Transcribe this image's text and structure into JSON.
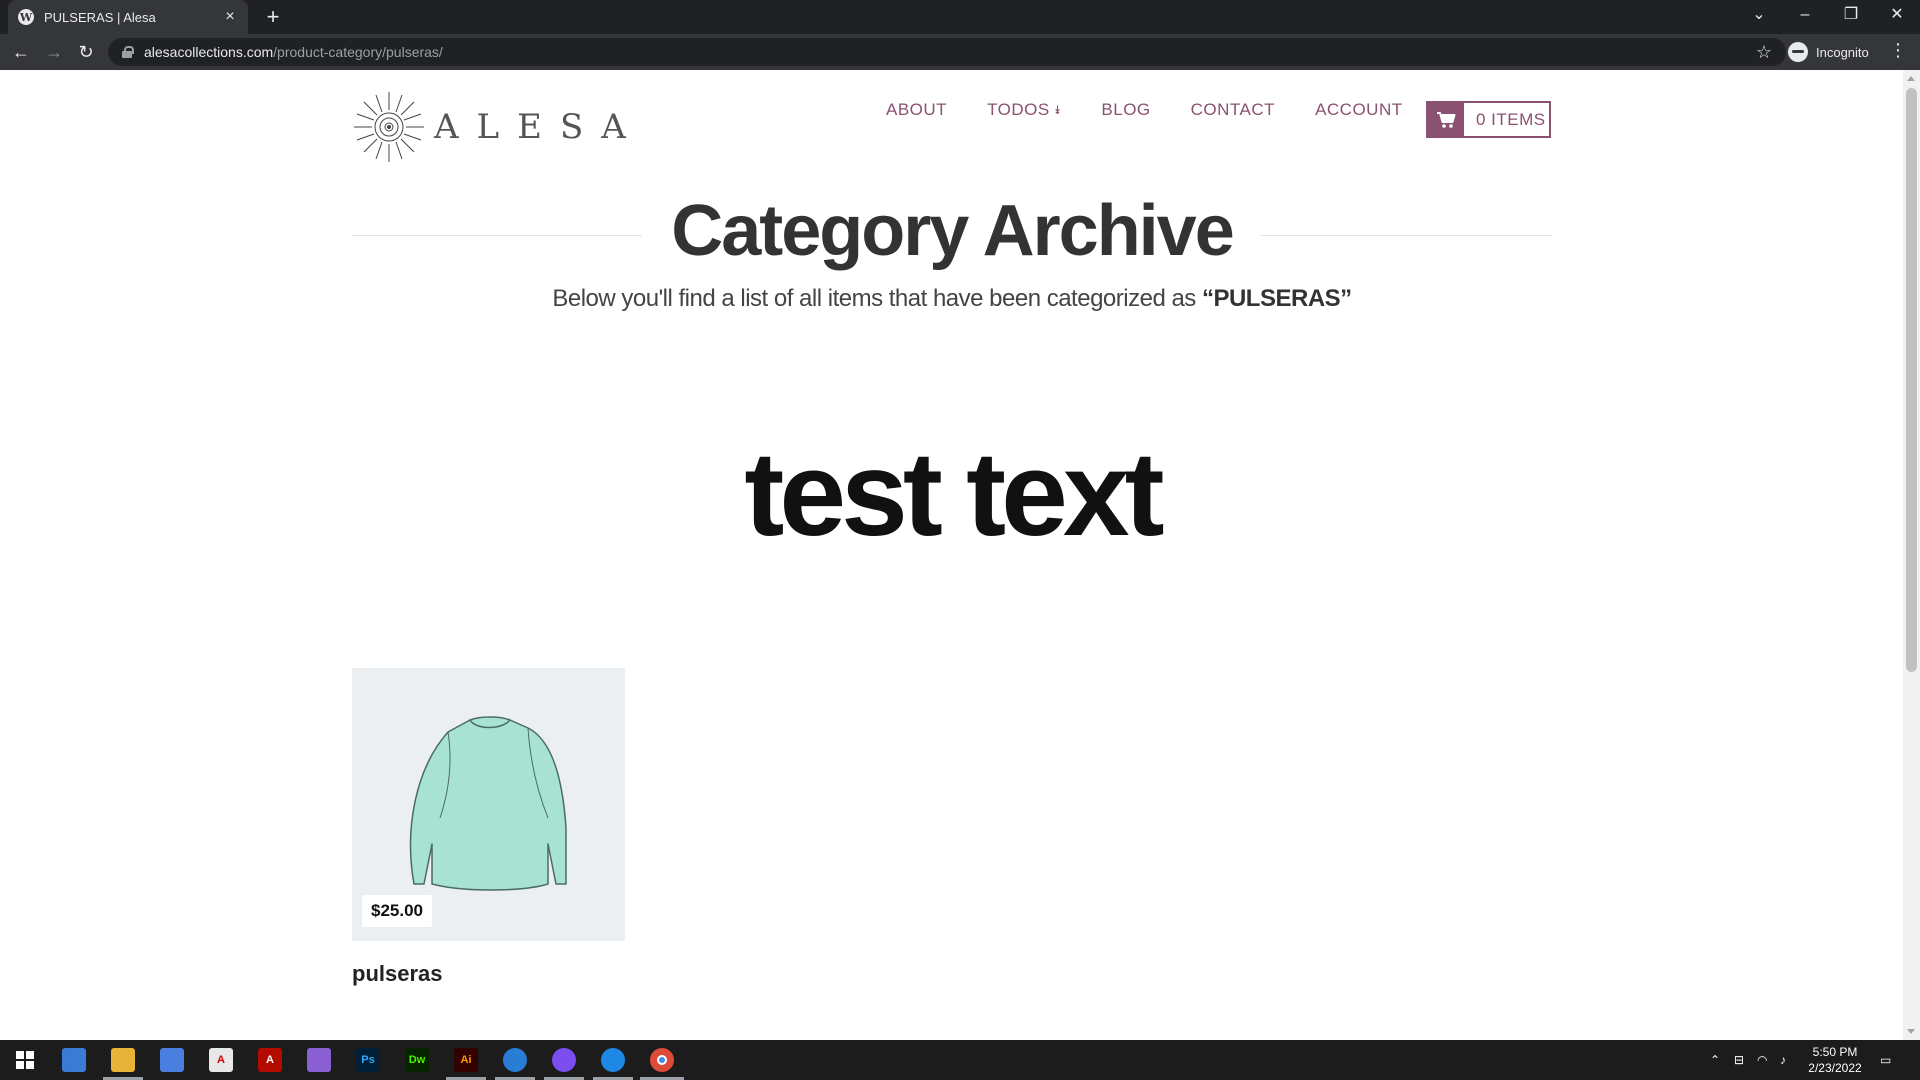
{
  "browser": {
    "tab_title": "PULSERAS | Alesa",
    "tab_favicon": "W",
    "url_host": "alesacollections.com",
    "url_path": "/product-category/pulseras/",
    "incognito_label": "Incognito"
  },
  "site": {
    "logo_text": "ALESA",
    "nav": {
      "about": "ABOUT",
      "todos": "TODOS",
      "blog": "BLOG",
      "contact": "CONTACT",
      "account": "ACCOUNT"
    },
    "cart_label": "0 ITEMS",
    "accent_color": "#8b5170"
  },
  "archive": {
    "title": "Category Archive",
    "subtitle_prefix": "Below you'll find a list of all items that have been categorized as ",
    "subtitle_category": "“PULSERAS”",
    "test_text": "test text"
  },
  "product": {
    "price": "$25.00",
    "name": "pulseras"
  },
  "taskbar": {
    "time": "5:50 PM",
    "date": "2/23/2022"
  }
}
